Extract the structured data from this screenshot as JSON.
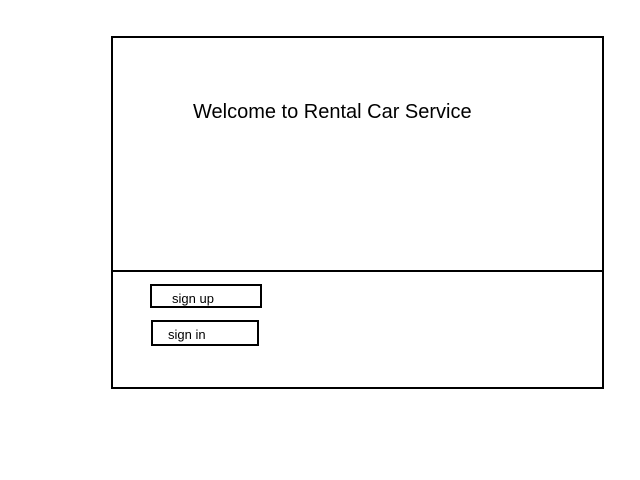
{
  "header": {
    "title": "Welcome to Rental Car Service"
  },
  "actions": {
    "sign_up_label": "sign up",
    "sign_in_label": "sign in"
  },
  "colors": {
    "border": "#000000",
    "background": "#ffffff",
    "text": "#000000"
  }
}
